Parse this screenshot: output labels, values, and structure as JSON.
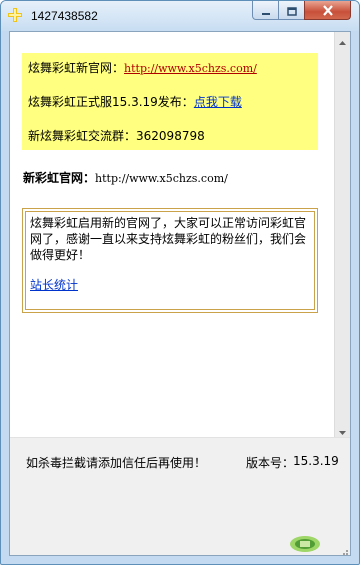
{
  "window": {
    "title": "1427438582",
    "app_icon": "plus-sparkle-icon",
    "controls": [
      "minimize-icon",
      "maximize-icon",
      "close-icon"
    ]
  },
  "promo": {
    "site_label": "炫舞彩虹新官网：",
    "site_url": "http://www.x5chzs.com/",
    "release_label": "炫舞彩虹正式服15.3.19发布：",
    "download_link": "点我下载",
    "group_label": "新炫舞彩虹交流群：",
    "group_number": "362098798"
  },
  "site_line": {
    "label": "新彩虹官网：",
    "url": "http://www.x5chzs.com/"
  },
  "notice": {
    "text": "炫舞彩虹启用新的官网了，大家可以正常访问彩虹官网了，感谢一直以来支持炫舞彩虹的粉丝们，我们会做得更好！",
    "stats_link": "站长统计"
  },
  "footer": {
    "warning": "如杀毒拦截请添加信任后再使用！",
    "version_label": "版本号：",
    "version_value": "15.3.19"
  },
  "colors": {
    "promo_background": "#ffff80",
    "link_red": "#b00000",
    "link_blue": "#0033cc",
    "notice_border": "#c9a24a",
    "close_button": "#c8503a"
  }
}
